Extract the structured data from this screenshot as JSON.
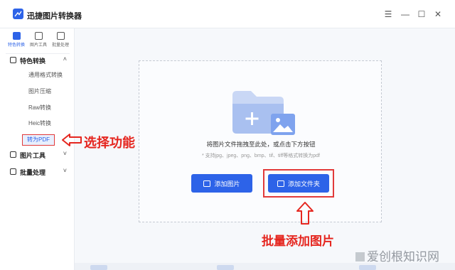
{
  "app": {
    "title": "迅捷图片转换器"
  },
  "window_controls": {
    "menu": "☰",
    "minimize": "—",
    "maximize": "☐",
    "close": "✕"
  },
  "top_tabs": [
    {
      "label": "特色转换",
      "icon": "swap-icon"
    },
    {
      "label": "图片工具",
      "icon": "image-tool-icon"
    },
    {
      "label": "批量处理",
      "icon": "batch-icon"
    }
  ],
  "sidebar": {
    "groups": [
      {
        "label": "特色转换",
        "icon": "swap-icon"
      },
      {
        "label": "图片工具",
        "icon": "image-tool-icon"
      },
      {
        "label": "批量处理",
        "icon": "batch-icon"
      }
    ],
    "items": [
      "通用格式转换",
      "图片压缩",
      "Raw转换",
      "Heic转换",
      "转为PDF"
    ]
  },
  "dropzone": {
    "main_text": "将图片文件拖拽至此处，或点击下方按钮",
    "sub_text": "* 支持jpg、jpeg、png、bmp、tif、tiff等格式转换为pdf"
  },
  "buttons": {
    "add_image": "添加图片",
    "add_folder": "添加文件夹"
  },
  "annotations": {
    "select_function": "选择功能",
    "batch_add": "批量添加图片"
  },
  "watermark": "爱创根知识网",
  "colors": {
    "accent": "#2d63e8",
    "annotation": "#e5261f"
  }
}
